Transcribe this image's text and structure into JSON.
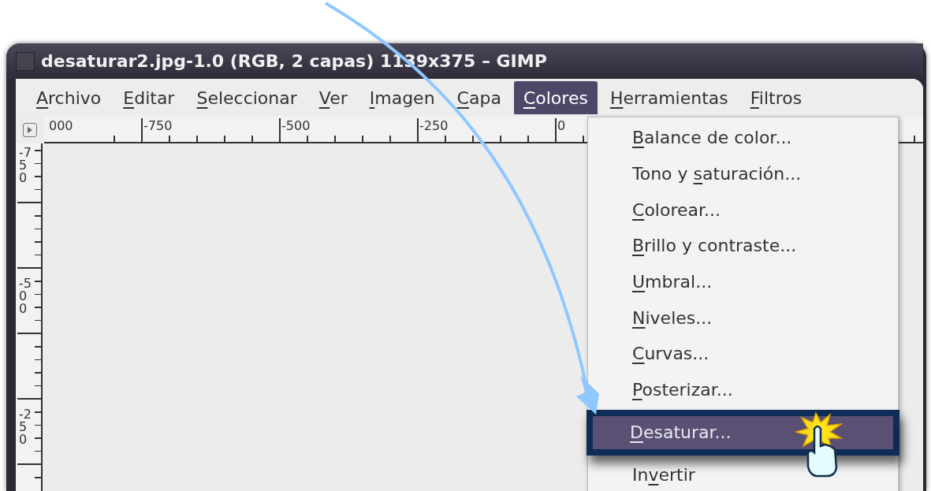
{
  "window": {
    "title": "desaturar2.jpg-1.0 (RGB, 2 capas) 1139x375 – GIMP"
  },
  "menubar": [
    {
      "key": "A",
      "rest": "rchivo",
      "selected": false
    },
    {
      "key": "E",
      "rest": "ditar",
      "selected": false
    },
    {
      "key": "S",
      "rest": "eleccionar",
      "selected": false
    },
    {
      "key": "V",
      "rest": "er",
      "selected": false
    },
    {
      "key": "I",
      "rest": "magen",
      "selected": false
    },
    {
      "key": "C",
      "rest": "apa",
      "selected": false
    },
    {
      "key": "C",
      "rest": "olores",
      "selected": true
    },
    {
      "key": "H",
      "rest": "erramientas",
      "selected": false
    },
    {
      "key": "F",
      "rest": "iltros",
      "selected": false
    }
  ],
  "horizontal_ruler": [
    "000",
    "-750",
    "-500",
    "-250",
    "0"
  ],
  "vertical_ruler": [
    "-750",
    "-500",
    "-250"
  ],
  "menu": [
    {
      "key": "B",
      "rest": "alance de color...",
      "selected": false
    },
    {
      "lead": "Tono y ",
      "key": "s",
      "rest": "aturación...",
      "selected": false
    },
    {
      "key": "C",
      "rest": "olorear...",
      "selected": false
    },
    {
      "key": "B",
      "rest": "rillo y contraste...",
      "selected": false
    },
    {
      "key": "U",
      "rest": "mbral...",
      "selected": false
    },
    {
      "key": "N",
      "rest": "iveles...",
      "selected": false
    },
    {
      "key": "C",
      "rest": "urvas...",
      "selected": false
    },
    {
      "key": "P",
      "rest": "osterizar...",
      "selected": false
    },
    {
      "key": "D",
      "rest": "esaturar...",
      "selected": true
    },
    {
      "lead": "In",
      "key": "v",
      "rest": "ertir",
      "selected": false
    }
  ]
}
